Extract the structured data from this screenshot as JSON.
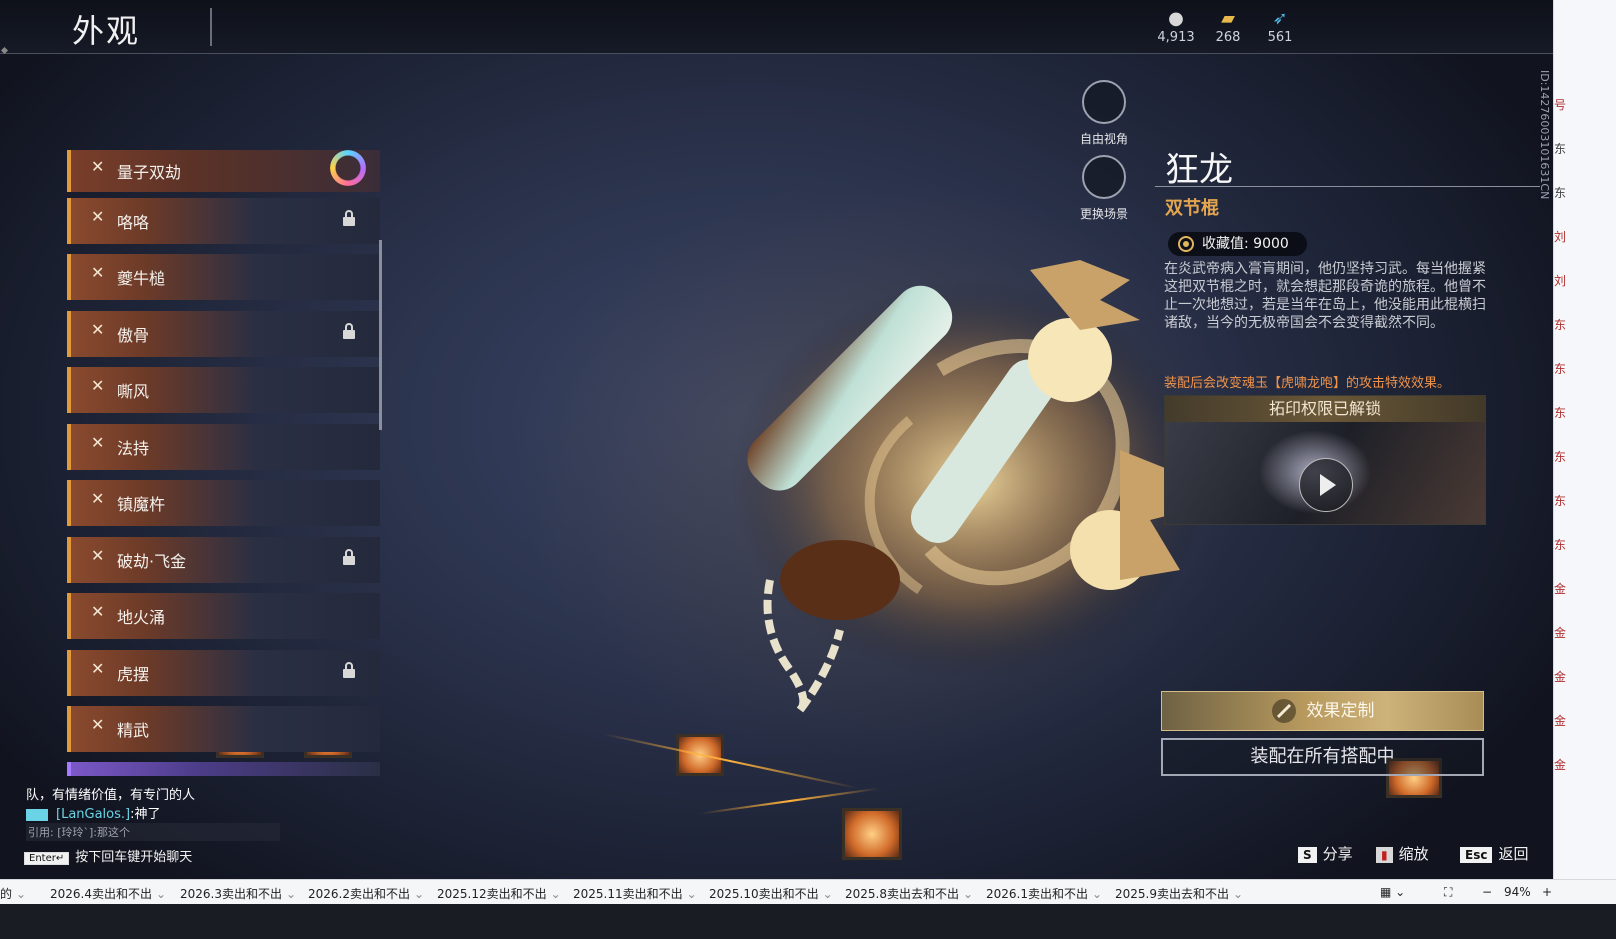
{
  "header": {
    "title": "外观",
    "currencies": [
      {
        "icon": "coin-stack-icon",
        "value": "4,913"
      },
      {
        "icon": "ticket-icon",
        "value": "268"
      },
      {
        "icon": "feather-icon",
        "value": "561"
      }
    ]
  },
  "weapon_list": {
    "items": [
      {
        "label": "量子双劫",
        "state": "selected",
        "badge": "rainbow-ring-icon"
      },
      {
        "label": "咯咯",
        "state": "locked"
      },
      {
        "label": "夔牛槌",
        "state": "normal"
      },
      {
        "label": "傲骨",
        "state": "locked"
      },
      {
        "label": "嘶风",
        "state": "normal"
      },
      {
        "label": "法持",
        "state": "normal"
      },
      {
        "label": "镇魔杵",
        "state": "normal"
      },
      {
        "label": "破劫·飞金",
        "state": "locked"
      },
      {
        "label": "地火涌",
        "state": "normal"
      },
      {
        "label": "虎摆",
        "state": "locked"
      },
      {
        "label": "精武",
        "state": "normal"
      }
    ]
  },
  "camera": {
    "free_view": "自由视角",
    "change_scene": "更换场景"
  },
  "detail": {
    "name": "狂龙",
    "type": "双节棍",
    "collect_label": "收藏值: 9000",
    "description": "在炎武帝病入膏肓期间，他仍坚持习武。每当他握紧这把双节棍之时，就会想起那段奇诡的旅程。他曾不止一次地想过，若是当年在岛上，他没能用此棍横扫诸敌，当今的无极帝国会不会变得截然不同。",
    "effect_note": "装配后会改变魂玉【虎啸龙咆】的攻击特效效果。",
    "preview_title": "拓印权限已解锁",
    "customize_button": "效果定制",
    "equip_all_button": "装配在所有搭配中"
  },
  "chat": {
    "line1": "队，有情绪价值，有专门的人",
    "line2_user": "[LanGalos.]",
    "line2_text": ":神了",
    "line3": "引用: [玲玲`]:那这个",
    "enter_key": "Enter↵",
    "prompt": "按下回车键开始聊天"
  },
  "hints": [
    {
      "key": "S",
      "label": "分享"
    },
    {
      "key": "",
      "label": "缩放"
    },
    {
      "key": "Esc",
      "label": "返回"
    }
  ],
  "side_id": "ID:14276003101631CN",
  "browser_tabs": [
    "的",
    "2026.4卖出和不出",
    "2026.3卖出和不出",
    "2026.2卖出和不出",
    "2025.12卖出和不出",
    "2025.11卖出和不出",
    "2025.10卖出和不出",
    "2025.8卖出去和不出",
    "2026.1卖出和不出",
    "2025.9卖出去和不出"
  ],
  "zoom": "94%",
  "edge_chars": [
    "号",
    "东",
    "东",
    "刘",
    "刘",
    "东",
    "东",
    "东",
    "东",
    "东",
    "东",
    "金",
    "金",
    "金",
    "金",
    "金"
  ],
  "colors": {
    "accent_orange": "#e39a3b",
    "type_gold": "#e3a54f",
    "effect_orange": "#f0934a",
    "chat_user_cyan": "#6ad3e6"
  }
}
